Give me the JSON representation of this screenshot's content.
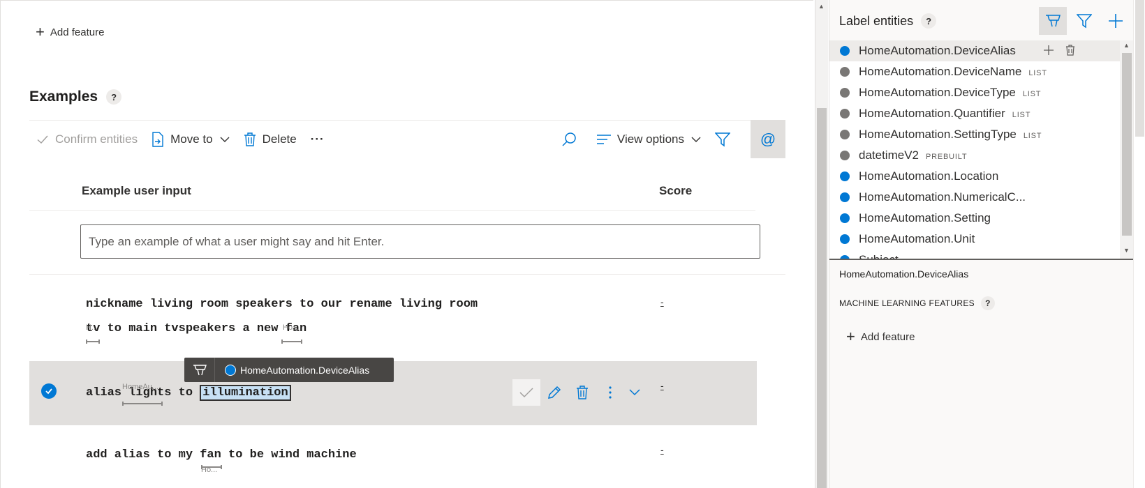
{
  "top": {
    "add_feature": "Add feature"
  },
  "examples": {
    "title": "Examples",
    "help": "?"
  },
  "toolbar": {
    "confirm": "Confirm entities",
    "move_to": "Move to",
    "delete": "Delete",
    "more": "···",
    "view_options": "View options",
    "at": "@"
  },
  "table": {
    "col_input": "Example user input",
    "col_score": "Score",
    "input_placeholder": "Type an example of what a user might say and hit Enter.",
    "rows": [
      {
        "line1": "nickname living room speakers to our rename living room",
        "line2_a": "tv",
        "line2_b": " to main tvspeakers a new ",
        "line2_c": "fan",
        "ent1_short": "H...",
        "ent2_short": "Ho...",
        "score": "-"
      },
      {
        "pre": "alias ",
        "ent1": "lights",
        "mid": " to ",
        "ent2": "illumination",
        "ent1_short": "HomeAu...",
        "score": "-",
        "selected": true
      },
      {
        "pre": "add alias to my ",
        "ent1": "fan",
        "post": " to be wind machine",
        "ent1_short": "Ho...",
        "score": "-"
      }
    ]
  },
  "tooltip": {
    "entity": "HomeAutomation.DeviceAlias"
  },
  "panel": {
    "title": "Label entities",
    "help": "?",
    "entities": [
      {
        "name": "HomeAutomation.DeviceAlias",
        "color": "blue",
        "tag": "",
        "selected": true
      },
      {
        "name": "HomeAutomation.DeviceName",
        "color": "gray",
        "tag": "LIST"
      },
      {
        "name": "HomeAutomation.DeviceType",
        "color": "gray",
        "tag": "LIST"
      },
      {
        "name": "HomeAutomation.Quantifier",
        "color": "gray",
        "tag": "LIST"
      },
      {
        "name": "HomeAutomation.SettingType",
        "color": "gray",
        "tag": "LIST"
      },
      {
        "name": "datetimeV2",
        "color": "gray",
        "tag": "PREBUILT"
      },
      {
        "name": "HomeAutomation.Location",
        "color": "blue",
        "tag": ""
      },
      {
        "name": "HomeAutomation.NumericalC...",
        "color": "blue",
        "tag": ""
      },
      {
        "name": "HomeAutomation.Setting",
        "color": "blue",
        "tag": ""
      },
      {
        "name": "HomeAutomation.Unit",
        "color": "blue",
        "tag": ""
      },
      {
        "name": "Subject",
        "color": "blue",
        "tag": ""
      }
    ],
    "detail_name": "HomeAutomation.DeviceAlias",
    "ml_features": "MACHINE LEARNING FEATURES",
    "add_feature": "Add feature"
  },
  "colors": {
    "accent": "#0078d4",
    "entity_gray": "#797775",
    "selected_row": "#e1dfdd"
  }
}
